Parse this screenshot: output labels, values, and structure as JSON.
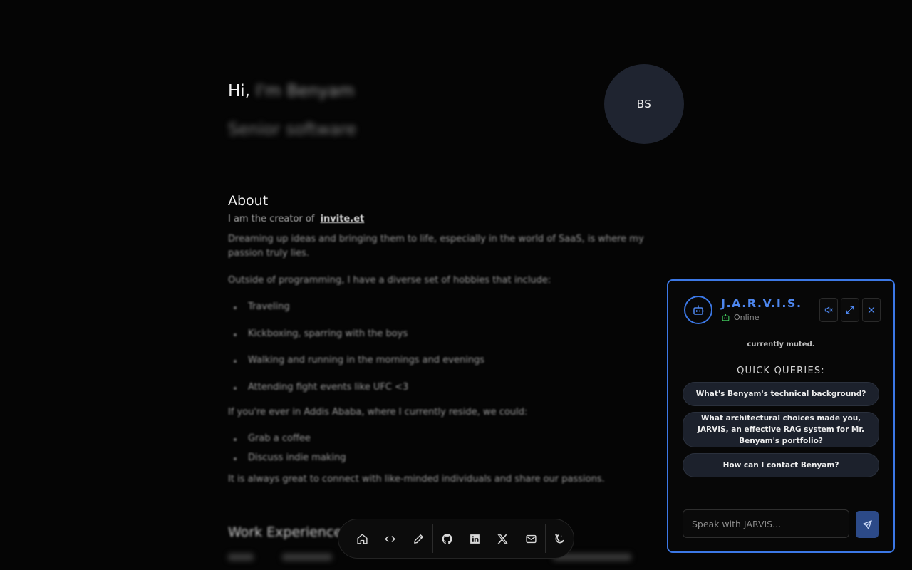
{
  "hero": {
    "greeting": "Hi,",
    "name_prefix": "I'm",
    "name": "Benyam",
    "role_prefix": "Senior",
    "role": "software"
  },
  "avatar": {
    "initials": "BS"
  },
  "about": {
    "title": "About",
    "intro": "I am the creator of",
    "intro_link": "invite.et",
    "paragraph1": "Dreaming up ideas and bringing them to life, especially in the world of SaaS, is where my passion truly lies.",
    "paragraph2": "Outside of programming, I have a diverse set of hobbies that include:",
    "hobbies": [
      "Traveling",
      "Kickboxing, sparring with the boys",
      "Walking and running in the mornings and evenings",
      "Attending fight events like UFC <3"
    ],
    "paragraph3": "If you're ever in Addis Ababa, where I currently reside, we could:",
    "activities": [
      "Grab a coffee",
      "Discuss indie making"
    ],
    "paragraph4": "It is always great to connect with like-minded individuals and share our passions."
  },
  "work": {
    "title": "Work Experience"
  },
  "dock": {
    "items": [
      "home-icon",
      "code-icon",
      "pencil-icon",
      "github-icon",
      "linkedin-icon",
      "x-icon",
      "mail-icon",
      "theme-toggle-icon"
    ]
  },
  "chat": {
    "title": "J.A.R.V.I.S.",
    "status": "Online",
    "muted_note": "currently muted.",
    "quick_title": "QUICK QUERIES:",
    "quick_queries": [
      "What's Benyam's technical background?",
      "What architectural choices made you, JARVIS, an effective RAG system for Mr. Benyam's portfolio?",
      "How can I contact Benyam?"
    ],
    "input_placeholder": "Speak with JARVIS...",
    "input_value": ""
  },
  "colors": {
    "accent": "#3c78e6",
    "status_online": "#3fc45a",
    "page_bg": "#050505"
  }
}
